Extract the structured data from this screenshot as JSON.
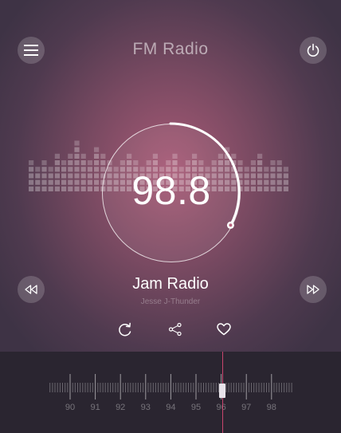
{
  "header": {
    "title": "FM Radio",
    "menu_icon": "menu-icon",
    "power_icon": "power-icon"
  },
  "player": {
    "frequency": "98.8",
    "station": "Jam Radio",
    "artist": "Jesse J-Thunder",
    "tuning_progress": 0.33,
    "prev_icon": "rewind-icon",
    "next_icon": "fast-forward-icon"
  },
  "actions": {
    "repeat_icon": "repeat-icon",
    "share_icon": "share-icon",
    "favorite_icon": "heart-icon"
  },
  "tuner": {
    "labels": [
      "90",
      "91",
      "92",
      "93",
      "94",
      "95",
      "96",
      "97",
      "98"
    ],
    "selected_label": "96"
  },
  "colors": {
    "accent": "#c9456e",
    "background": "#7a4a62",
    "tuner_background": "#2a2530"
  }
}
